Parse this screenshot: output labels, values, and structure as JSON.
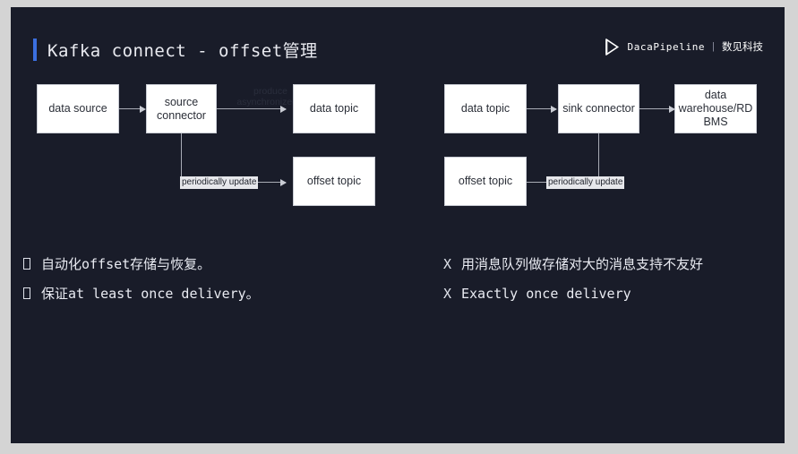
{
  "slide": {
    "background_color": "#191c29",
    "accent_color": "#3b6fe0",
    "title": "Kafka connect - offset管理"
  },
  "logo": {
    "icon": "play-arrow-outline-icon",
    "name": "DacaPipeline",
    "separator": "|",
    "company": "数见科技"
  },
  "diagram_left": {
    "nodes": [
      {
        "id": "data-source",
        "label": "data source"
      },
      {
        "id": "source-connector",
        "label": "source\nconnector"
      },
      {
        "id": "data-topic",
        "label": "data topic"
      },
      {
        "id": "offset-topic",
        "label": "offset topic"
      }
    ],
    "edge_labels": {
      "produce": "produce\nasynchronizedly",
      "periodic": "periodically update"
    }
  },
  "diagram_right": {
    "nodes": [
      {
        "id": "data-topic",
        "label": "data topic"
      },
      {
        "id": "sink-connector",
        "label": "sink connector"
      },
      {
        "id": "data-warehouse",
        "label": "data\nwarehouse/RD\nBMS"
      },
      {
        "id": "offset-topic",
        "label": "offset topic"
      }
    ],
    "edge_labels": {
      "periodic": "periodically update"
    }
  },
  "bullets_left": {
    "marker": "tofu-box",
    "items": [
      "自动化offset存储与恢复。",
      "保证at least once delivery。"
    ]
  },
  "bullets_right": {
    "marker": "X",
    "items": [
      "用消息队列做存储对大的消息支持不友好",
      "Exactly once delivery"
    ]
  }
}
